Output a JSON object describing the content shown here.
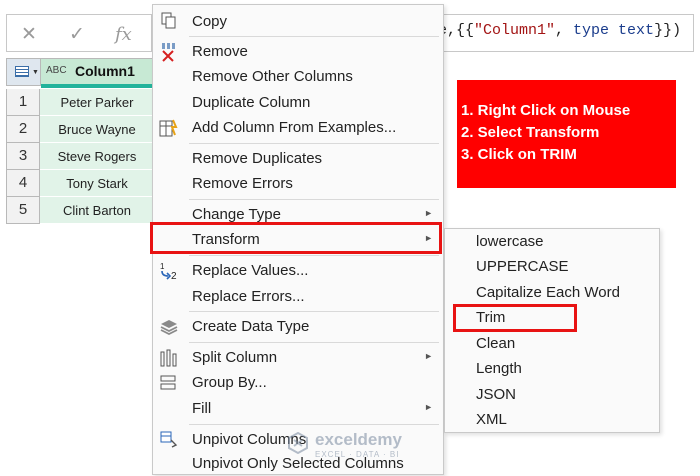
{
  "formula_bar": {
    "cancel_icon": "x-icon",
    "confirm_icon": "check-icon",
    "fx_label": "fx",
    "formula_prefix": "e,{{",
    "formula_string": "\"Column1\"",
    "formula_sep": ", ",
    "formula_type": "type text",
    "formula_suffix": "}})"
  },
  "grid": {
    "column_type": "ABC",
    "column_name": "Column1",
    "rows": [
      {
        "num": "1",
        "value": "Peter Parker"
      },
      {
        "num": "2",
        "value": "Bruce Wayne"
      },
      {
        "num": "3",
        "value": "Steve Rogers"
      },
      {
        "num": "4",
        "value": "Tony Stark"
      },
      {
        "num": "5",
        "value": "Clint Barton"
      }
    ]
  },
  "instructions": [
    "1. Right Click on Mouse",
    "2. Select Transform",
    "3. Click on TRIM"
  ],
  "context_menu": {
    "items": [
      {
        "label": "Copy",
        "icon": "copy-icon"
      },
      {
        "label": "Remove",
        "icon": "remove-column-icon"
      },
      {
        "label": "Remove Other Columns",
        "icon": ""
      },
      {
        "label": "Duplicate Column",
        "icon": ""
      },
      {
        "label": "Add Column From Examples...",
        "icon": "add-column-examples-icon"
      },
      {
        "label": "Remove Duplicates",
        "icon": ""
      },
      {
        "label": "Remove Errors",
        "icon": ""
      },
      {
        "label": "Change Type",
        "icon": "",
        "submenu": true
      },
      {
        "label": "Transform",
        "icon": "",
        "submenu": true
      },
      {
        "label": "Replace Values...",
        "icon": "replace-values-icon"
      },
      {
        "label": "Replace Errors...",
        "icon": ""
      },
      {
        "label": "Create Data Type",
        "icon": "data-type-icon"
      },
      {
        "label": "Split Column",
        "icon": "split-column-icon",
        "submenu": true
      },
      {
        "label": "Group By...",
        "icon": "group-by-icon"
      },
      {
        "label": "Fill",
        "icon": "",
        "submenu": true
      },
      {
        "label": "Unpivot Columns",
        "icon": "unpivot-icon"
      },
      {
        "label": "Unpivot Only Selected Columns",
        "icon": ""
      }
    ]
  },
  "transform_submenu": {
    "items": [
      "lowercase",
      "UPPERCASE",
      "Capitalize Each Word",
      "Trim",
      "Clean",
      "Length",
      "JSON",
      "XML"
    ]
  },
  "watermark": {
    "name": "exceldemy",
    "tagline": "EXCEL · DATA · BI"
  },
  "colors": {
    "highlight": "#e81313",
    "instruction_bg": "#ff0000",
    "column_header": "#c7e9d4",
    "column_accent": "#22b39b"
  }
}
